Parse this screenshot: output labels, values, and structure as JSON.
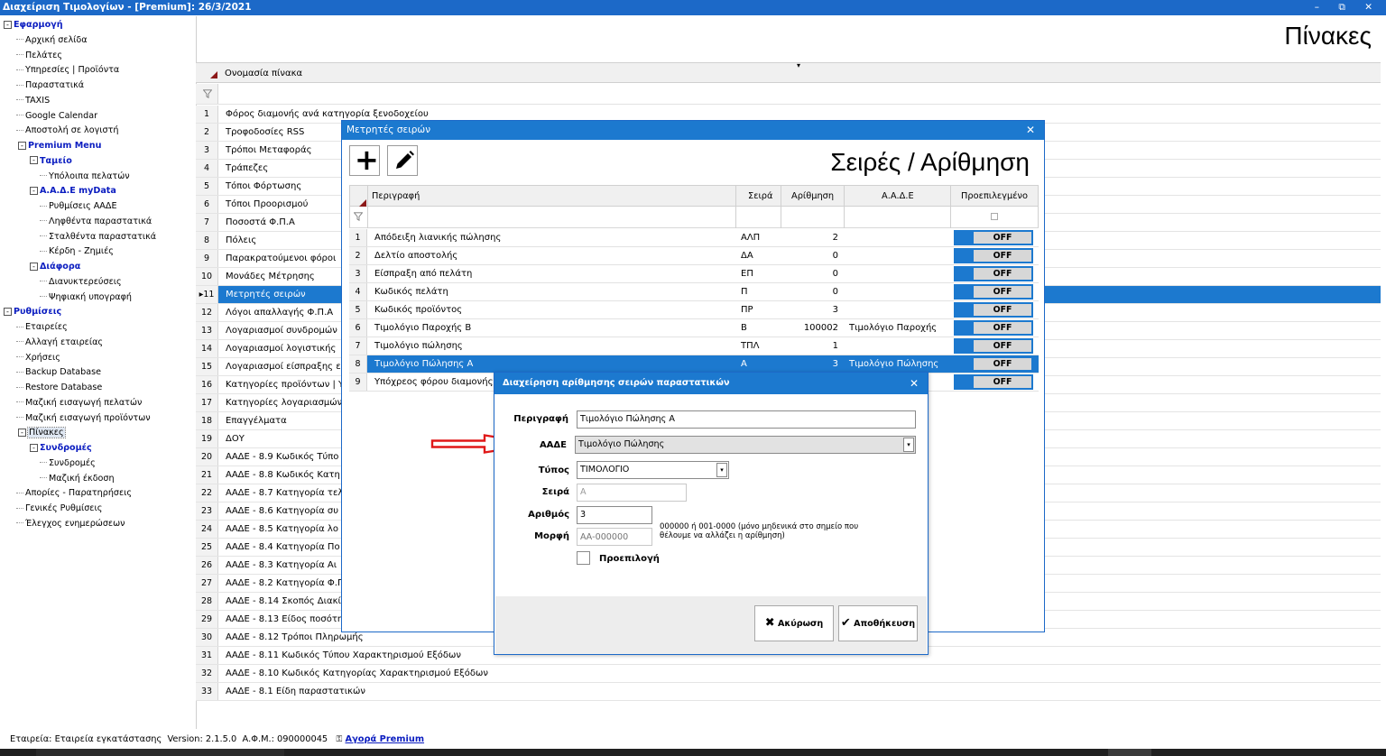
{
  "window": {
    "title": "Διαχείριση Τιμολογίων - [Premium]: 26/3/2021",
    "controls": "– ⧉ ✕"
  },
  "page_title": "Πίνακες",
  "tree": [
    {
      "label": "Εφαρμογή",
      "level": 0,
      "type": "group",
      "box": "-"
    },
    {
      "label": "Αρχική σελίδα",
      "level": 1
    },
    {
      "label": "Πελάτες",
      "level": 1
    },
    {
      "label": "Υπηρεσίες | Προϊόντα",
      "level": 1
    },
    {
      "label": "Παραστατικά",
      "level": 1
    },
    {
      "label": "TAXIS",
      "level": 1
    },
    {
      "label": "Google Calendar",
      "level": 1
    },
    {
      "label": "Αποστολή σε λογιστή",
      "level": 1
    },
    {
      "label": "Premium Menu",
      "level": 1,
      "type": "group",
      "box": "-"
    },
    {
      "label": "Ταμείο",
      "level": 2,
      "type": "group",
      "box": "-"
    },
    {
      "label": "Υπόλοιπα πελατών",
      "level": 3
    },
    {
      "label": "Α.Α.Δ.Ε myData",
      "level": 2,
      "type": "group",
      "box": "-"
    },
    {
      "label": "Ρυθμίσεις ΑΑΔΕ",
      "level": 3
    },
    {
      "label": "Ληφθέντα παραστατικά",
      "level": 3
    },
    {
      "label": "Σταλθέντα παραστατικά",
      "level": 3
    },
    {
      "label": "Κέρδη - Ζημιές",
      "level": 3
    },
    {
      "label": "Διάφορα",
      "level": 2,
      "type": "group",
      "box": "-"
    },
    {
      "label": "Διανυκτερεύσεις",
      "level": 3
    },
    {
      "label": "Ψηφιακή υπογραφή",
      "level": 3
    },
    {
      "label": "Ρυθμίσεις",
      "level": 0,
      "type": "group",
      "box": "-"
    },
    {
      "label": "Εταιρείες",
      "level": 1
    },
    {
      "label": "Αλλαγή εταιρείας",
      "level": 1
    },
    {
      "label": "Χρήσεις",
      "level": 1
    },
    {
      "label": "Backup Database",
      "level": 1
    },
    {
      "label": "Restore Database",
      "level": 1
    },
    {
      "label": "Μαζική εισαγωγή πελατών",
      "level": 1
    },
    {
      "label": "Μαζική εισαγωγή προϊόντων",
      "level": 1
    },
    {
      "label": "Πίνακες",
      "level": 1,
      "box": "-",
      "selected": true
    },
    {
      "label": "Συνδρομές",
      "level": 2,
      "type": "group",
      "box": "-"
    },
    {
      "label": "Συνδρομές",
      "level": 3
    },
    {
      "label": "Μαζική έκδοση",
      "level": 3
    },
    {
      "label": "Απορίες - Παρατηρήσεις",
      "level": 1
    },
    {
      "label": "Γενικές Ρυθμίσεις",
      "level": 1
    },
    {
      "label": "Έλεγχος ενημερώσεων",
      "level": 1
    }
  ],
  "tables_grid": {
    "column_header": "Ονομασία πίνακα",
    "rows": [
      "Φόρος διαμονής ανά κατηγορία ξενοδοχείου",
      "Τροφοδοσίες RSS",
      "Τρόποι Μεταφοράς",
      "Τράπεζες",
      "Τόποι Φόρτωσης",
      "Τόποι Προορισμού",
      "Ποσοστά Φ.Π.Α",
      "Πόλεις",
      "Παρακρατούμενοι φόροι",
      "Μονάδες Μέτρησης",
      "Μετρητές σειρών",
      "Λόγοι απαλλαγής Φ.Π.Α",
      "Λογαριασμοί συνδρομών",
      "Λογαριασμοί λογιστικής",
      "Λογαριασμοί είσπραξης ε",
      "Κατηγορίες προϊόντων | Υ",
      "Κατηγορίες λογαριασμών",
      "Επαγγέλματα",
      "ΔΟΥ",
      "ΑΑΔΕ - 8.9 Κωδικός Τύπο",
      "ΑΑΔΕ - 8.8 Κωδικός Κατη",
      "ΑΑΔΕ - 8.7 Κατηγορία τελ",
      "ΑΑΔΕ - 8.6 Κατηγορία συ",
      "ΑΑΔΕ - 8.5 Κατηγορία λο",
      "ΑΑΔΕ - 8.4 Κατηγορία Πο",
      "ΑΑΔΕ - 8.3 Κατηγορία Αι",
      "ΑΑΔΕ - 8.2 Κατηγορία Φ.Π",
      "ΑΑΔΕ - 8.14 Σκοπός Διακί",
      "ΑΑΔΕ - 8.13 Είδος ποσότη",
      "ΑΑΔΕ - 8.12 Τρόποι Πληρωμής",
      "ΑΑΔΕ - 8.11 Κωδικός Τύπου Χαρακτηρισμού Εξόδων",
      "ΑΑΔΕ - 8.10 Κωδικός Κατηγορίας Χαρακτηρισμού Εξόδων",
      "ΑΑΔΕ - 8.1 Είδη παραστατικών"
    ],
    "selected_index": 10
  },
  "counters_dialog": {
    "caption": "Μετρητές σειρών",
    "close": "✕",
    "title": "Σειρές / Αρίθμηση",
    "add_button": "+",
    "columns": [
      "Περιγραφή",
      "Σειρά",
      "Αρίθμηση",
      "Α.Α.Δ.Ε",
      "Προεπιλεγμένο"
    ],
    "rows": [
      {
        "n": "1",
        "desc": "Απόδειξη λιανικής πώλησης",
        "series": "ΑΛΠ",
        "count": "2",
        "aade": "",
        "default": "OFF"
      },
      {
        "n": "2",
        "desc": "Δελτίο αποστολής",
        "series": "ΔΑ",
        "count": "0",
        "aade": "",
        "default": "OFF"
      },
      {
        "n": "3",
        "desc": "Είσπραξη από πελάτη",
        "series": "ΕΠ",
        "count": "0",
        "aade": "",
        "default": "OFF"
      },
      {
        "n": "4",
        "desc": "Κωδικός πελάτη",
        "series": "Π",
        "count": "0",
        "aade": "",
        "default": "OFF"
      },
      {
        "n": "5",
        "desc": "Κωδικός προϊόντος",
        "series": "ΠΡ",
        "count": "3",
        "aade": "",
        "default": "OFF"
      },
      {
        "n": "6",
        "desc": "Τιμολόγιο Παροχής Β",
        "series": "Β",
        "count": "100002",
        "aade": "Τιμολόγιο Παροχής",
        "default": "OFF"
      },
      {
        "n": "7",
        "desc": "Τιμολόγιο πώλησης",
        "series": "ΤΠΛ",
        "count": "1",
        "aade": "",
        "default": "OFF"
      },
      {
        "n": "8",
        "desc": "Τιμολόγιο Πώλησης Α",
        "series": "Α",
        "count": "3",
        "aade": "Τιμολόγιο Πώλησης",
        "default": "OFF"
      },
      {
        "n": "9",
        "desc": "Υπόχρεος φόρου διαμονής",
        "series": "",
        "count": "",
        "aade": "",
        "default": "OFF"
      }
    ],
    "selected_index": 7
  },
  "numbering_dialog": {
    "caption": "Διαχείρηση αρίθμησης σειρών παραστατικών",
    "close": "✕",
    "labels": {
      "description": "Περιγραφή",
      "aade": "ΑΑΔΕ",
      "type": "Τύπος",
      "series": "Σειρά",
      "number": "Αριθμός",
      "format": "Μορφή",
      "default": "Προεπιλογή"
    },
    "values": {
      "description": "Τιμολόγιο Πώλησης Α",
      "aade": "Τιμολόγιο Πώλησης",
      "type": "ΤΙΜΟΛΟΓΙΟ",
      "series": "Α",
      "number": "3"
    },
    "placeholders": {
      "format": "ΑΑ-000000"
    },
    "hint_line1": "000000 ή 001-0000 (μόνο μηδενικά στο σημείο που",
    "hint_line2": "θέλουμε να αλλάζει η αρίθμηση)",
    "cancel_label": "Ακύρωση",
    "save_label": "Αποθήκευση",
    "default_checked": false
  },
  "statusbar": {
    "company": "Εταιρεία: Εταιρεία εγκατάστασης",
    "version": "Version: 2.1.5.0",
    "afm": "Α.Φ.Μ.: 090000045",
    "premium_link": "Αγορά Premium"
  },
  "colors": {
    "accent": "#1c79cf",
    "titlebar": "#1c69c8",
    "tree_group": "#0a1cc0",
    "arrow": "#e01818"
  }
}
